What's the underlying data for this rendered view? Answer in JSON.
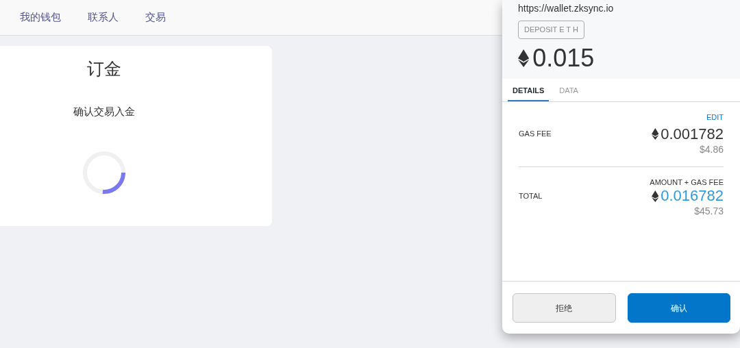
{
  "nav": {
    "items": [
      {
        "label": "我的钱包"
      },
      {
        "label": "联系人"
      },
      {
        "label": "交易"
      }
    ]
  },
  "card": {
    "title": "订金",
    "message": "确认交易入金"
  },
  "popup": {
    "origin": "https://wallet.zksync.io",
    "action_badge": "DEPOSIT E T H",
    "amount": "0.015",
    "tabs": [
      {
        "label": "DETAILS",
        "selected": true
      },
      {
        "label": "DATA",
        "selected": false
      }
    ],
    "edit_link": "EDIT",
    "rows": [
      {
        "kind": "fee",
        "label": "GAS FEE",
        "value": "0.001782",
        "fiat": "$4.86"
      },
      {
        "kind": "total",
        "caption": "AMOUNT + GAS FEE",
        "label": "TOTAL",
        "value": "0.016782",
        "fiat": "$45.73"
      }
    ],
    "buttons": [
      {
        "kind": "secondary",
        "label": "拒绝"
      },
      {
        "kind": "primary",
        "label": "确认"
      }
    ]
  }
}
